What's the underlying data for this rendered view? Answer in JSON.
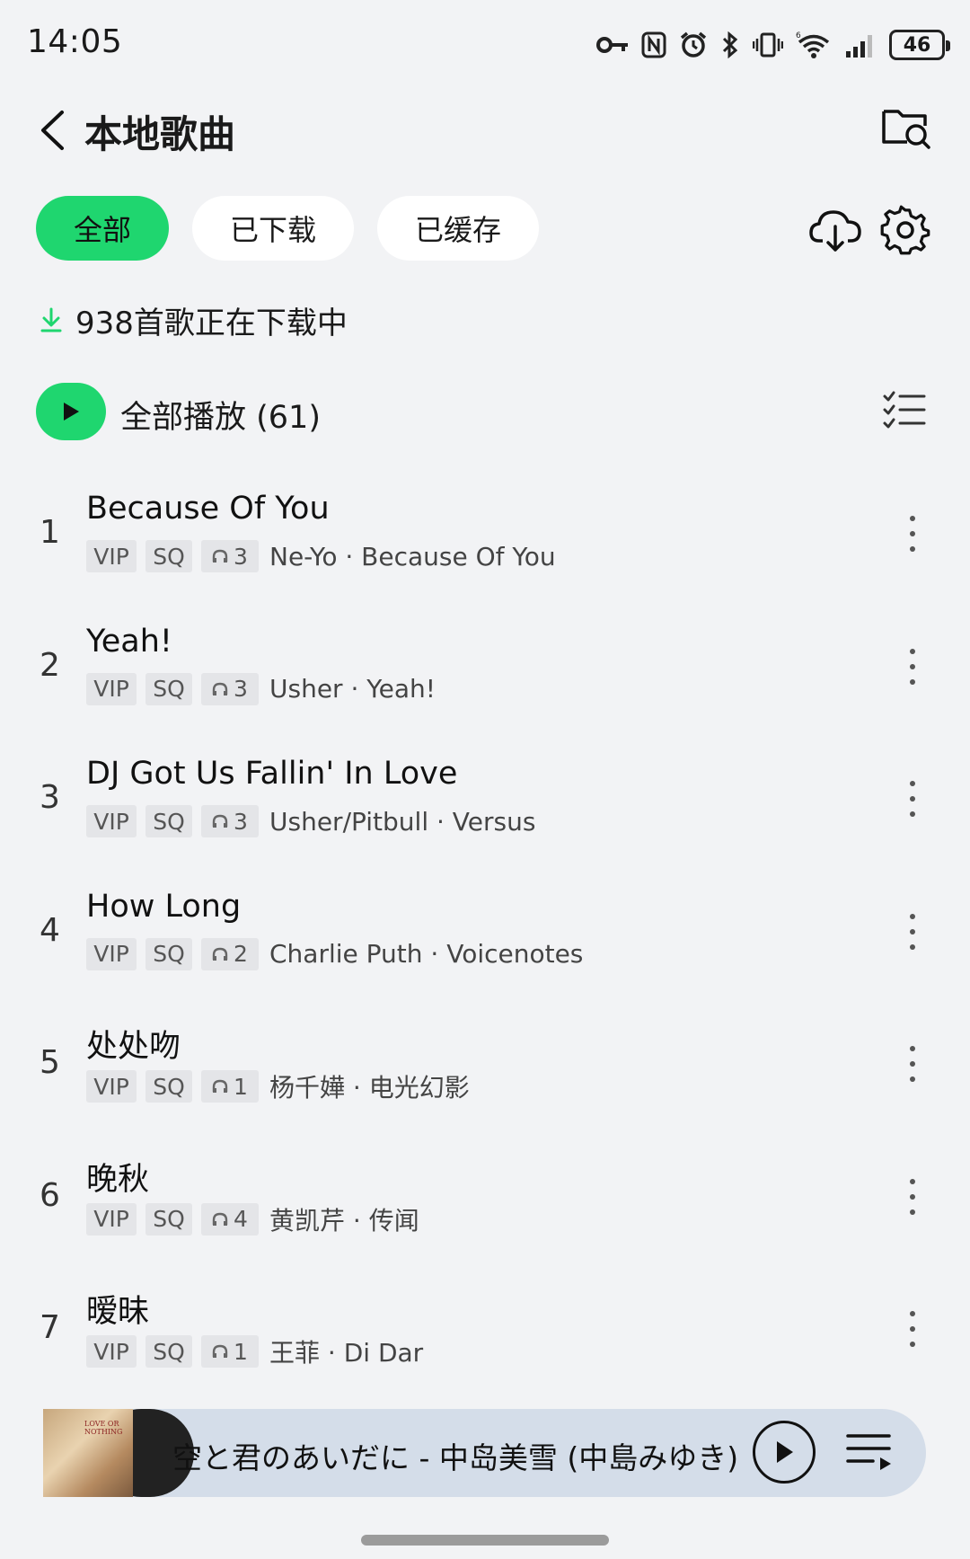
{
  "status_bar": {
    "time": "14:05",
    "battery": "46",
    "icons": [
      "key-icon",
      "nfc-icon",
      "alarm-icon",
      "bluetooth-icon",
      "vibrate-icon",
      "wifi-icon",
      "signal-icon",
      "battery-icon"
    ]
  },
  "header": {
    "title": "本地歌曲",
    "back_icon": "chevron-left-icon",
    "search_icon": "folder-search-icon"
  },
  "filters": {
    "tabs": [
      {
        "label": "全部",
        "active": true
      },
      {
        "label": "已下载",
        "active": false
      },
      {
        "label": "已缓存",
        "active": false
      }
    ],
    "cloud_icon": "cloud-download-icon",
    "settings_icon": "gear-icon"
  },
  "download_notice": "938首歌正在下载中",
  "play_all": {
    "label": "全部播放 (61)"
  },
  "songs": [
    {
      "index": "1",
      "title": "Because Of You",
      "vip": "VIP",
      "sq": "SQ",
      "listens": "3",
      "artist_album": "Ne-Yo · Because Of You"
    },
    {
      "index": "2",
      "title": "Yeah!",
      "vip": "VIP",
      "sq": "SQ",
      "listens": "3",
      "artist_album": "Usher · Yeah!"
    },
    {
      "index": "3",
      "title": "DJ Got Us Fallin' In Love",
      "vip": "VIP",
      "sq": "SQ",
      "listens": "3",
      "artist_album": "Usher/Pitbull · Versus"
    },
    {
      "index": "4",
      "title": "How Long",
      "vip": "VIP",
      "sq": "SQ",
      "listens": "2",
      "artist_album": "Charlie Puth · Voicenotes"
    },
    {
      "index": "5",
      "title": "处处吻",
      "vip": "VIP",
      "sq": "SQ",
      "listens": "1",
      "artist_album": "杨千嬅 · 电光幻影"
    },
    {
      "index": "6",
      "title": "晚秋",
      "vip": "VIP",
      "sq": "SQ",
      "listens": "4",
      "artist_album": "黄凯芹 · 传闻"
    },
    {
      "index": "7",
      "title": "暧昧",
      "vip": "VIP",
      "sq": "SQ",
      "listens": "1",
      "artist_album": "王菲 · Di Dar"
    }
  ],
  "mini_player": {
    "now_playing": "空と君のあいだに - 中岛美雪 (中島みゆき)",
    "album_text": "LOVE OR NOTHING"
  },
  "colors": {
    "accent": "#1fd66f",
    "background": "#f2f3f5",
    "player_bg": "#d4dde9"
  }
}
